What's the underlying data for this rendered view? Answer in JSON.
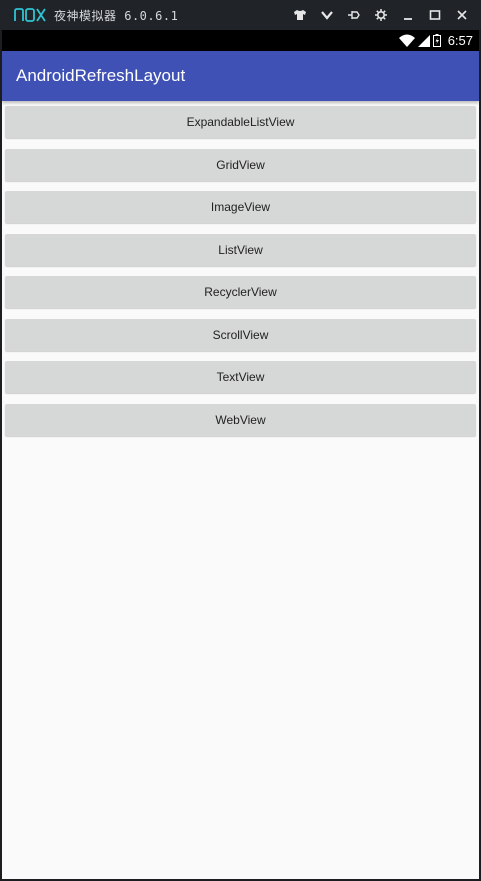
{
  "emulator": {
    "title": "夜神模拟器 6.0.6.1",
    "logo_icon": "nox-logo",
    "controls": [
      "shirt-icon",
      "chevron-down-icon",
      "pin-icon",
      "gear-icon",
      "minimize-icon",
      "maximize-icon",
      "close-icon"
    ],
    "accent_color": "#2ec5d3"
  },
  "status_bar": {
    "time": "6:57",
    "icons": [
      "wifi-icon",
      "signal-icon",
      "battery-icon"
    ]
  },
  "app_bar": {
    "title": "AndroidRefreshLayout",
    "color": "#3f51b5"
  },
  "buttons": [
    {
      "label": "ExpandableListView"
    },
    {
      "label": "GridView"
    },
    {
      "label": "ImageView"
    },
    {
      "label": "ListView"
    },
    {
      "label": "RecyclerView"
    },
    {
      "label": "ScrollView"
    },
    {
      "label": "TextView"
    },
    {
      "label": "WebView"
    }
  ]
}
